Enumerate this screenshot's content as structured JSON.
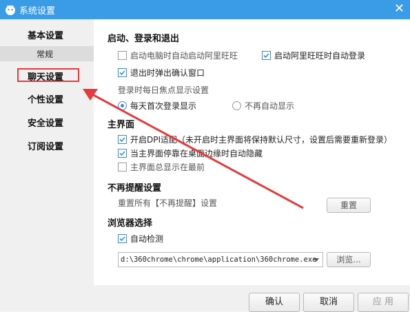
{
  "window": {
    "title": "系统设置",
    "close_label": "✕"
  },
  "sidebar": {
    "items": [
      {
        "label": "基本设置"
      },
      {
        "label": "常规"
      },
      {
        "label": "聊天设置"
      },
      {
        "label": "个性设置"
      },
      {
        "label": "安全设置"
      },
      {
        "label": "订阅设置"
      }
    ]
  },
  "content": {
    "login_section": {
      "title": "启动、登录和退出",
      "auto_start_wangwang": {
        "label": "启动电脑时自动启动阿里旺旺",
        "checked": false
      },
      "auto_login": {
        "label": "启动阿里旺旺时自动登录",
        "checked": true
      },
      "exit_confirm": {
        "label": "退出时弹出确认窗口",
        "checked": true
      },
      "focus_title": "登录时每日焦点显示设置",
      "focus_daily_first": {
        "label": "每天首次登录显示",
        "selected": true
      },
      "focus_never": {
        "label": "不再自动显示",
        "selected": false
      }
    },
    "main_section": {
      "title": "主界面",
      "dpi_adapt": {
        "label": "开启DPI适配（未开启时主界面将保持默认尺寸，设置后需要重新登录）",
        "checked": true
      },
      "auto_hide": {
        "label": "当主界面停靠在桌面边缘时自动隐藏",
        "checked": true
      },
      "always_on_top": {
        "label": "主界面总显示在最前",
        "checked": false
      }
    },
    "no_remind_section": {
      "title": "不再提醒设置",
      "reset_text": "重置所有【不再提醒】设置",
      "reset_button": "重置"
    },
    "browser_section": {
      "title": "浏览器选择",
      "auto_detect": {
        "label": "自动检测",
        "checked": true
      },
      "path_value": "d:\\360chrome\\chrome\\application\\360chrome.exe",
      "browse_button": "浏览..."
    }
  },
  "footer": {
    "ok_label": "确认",
    "cancel_label": "取消",
    "apply_label": "应 用"
  },
  "colors": {
    "titlebar": "#3a9be6",
    "accent": "#3b87d6",
    "annotation": "#e53b3b"
  }
}
